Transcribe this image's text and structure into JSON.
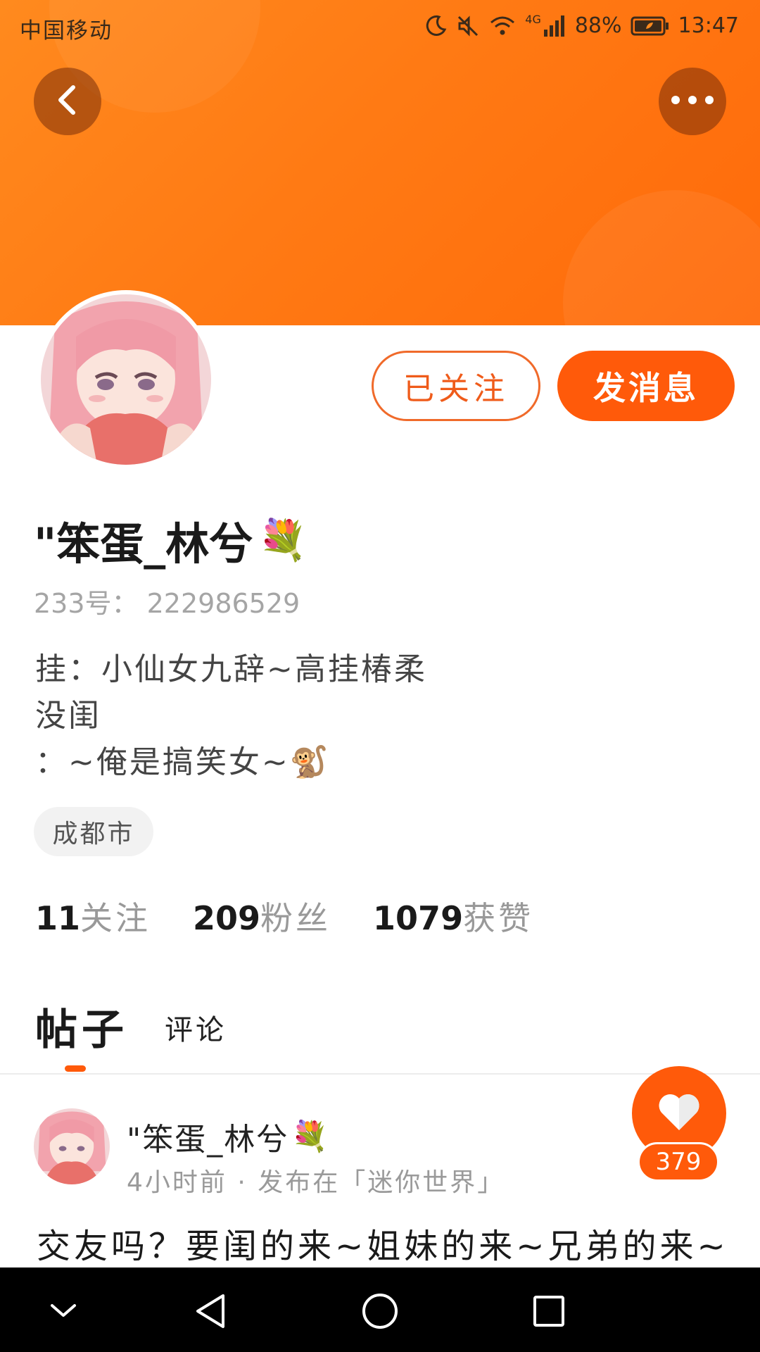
{
  "status_bar": {
    "carrier": "中国移动",
    "network": "4G",
    "battery_percent": "88%",
    "time": "13:47",
    "icons": [
      "moon-icon",
      "mute-icon",
      "wifi-icon",
      "signal-icon",
      "battery-icon"
    ]
  },
  "header": {
    "back_icon": "chevron-left-icon",
    "more_icon": "more-dots-icon"
  },
  "profile": {
    "follow_button_label": "已关注",
    "message_button_label": "发消息",
    "nickname": "\"笨蛋_林兮",
    "nickname_emoji": "💐",
    "uid_label": "233号：",
    "uid_value": "222986529",
    "bio_lines": [
      "挂：小仙女九辞~高挂椿柔",
      "没闺",
      "：~俺是搞笑女~"
    ],
    "bio_emoji": "🐒",
    "location": "成都市",
    "stats": [
      {
        "value": "11",
        "label": "关注"
      },
      {
        "value": "209",
        "label": "粉丝"
      },
      {
        "value": "1079",
        "label": "获赞"
      }
    ]
  },
  "tabs": [
    {
      "label": "帖子",
      "active": true
    },
    {
      "label": "评论",
      "active": false
    }
  ],
  "post": {
    "author": "\"笨蛋_林兮",
    "author_emoji": "💐",
    "meta": "4小时前 · 发布在「迷你世界」",
    "body": "交友吗？要闺的来~姐妹的来~兄弟的来~",
    "like_count": "379"
  },
  "nav_bar": {
    "icons": [
      "collapse-icon",
      "back-triangle-icon",
      "home-circle-icon",
      "recents-square-icon"
    ]
  },
  "colors": {
    "accent": "#ff5a0a",
    "banner_start": "#ff8a1e",
    "banner_end": "#ff6a0a",
    "muted_text": "#999999"
  }
}
